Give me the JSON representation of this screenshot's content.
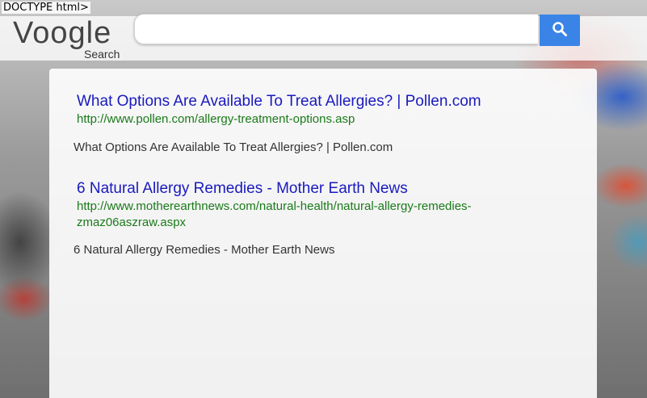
{
  "page": {
    "doctype_text": "DOCTYPE html>"
  },
  "header": {
    "logo": "Voogle",
    "logo_subtitle": "Search",
    "search_value": "",
    "search_icon": "search-icon",
    "accent_color": "#3a84e8"
  },
  "results": [
    {
      "title": "What Options Are Available To Treat Allergies? | Pollen.com",
      "url": "http://www.pollen.com/allergy-treatment-options.asp",
      "snippet": "What Options Are Available To Treat Allergies? | Pollen.com"
    },
    {
      "title": "6 Natural Allergy Remedies - Mother Earth News",
      "url": "http://www.motherearthnews.com/natural-health/natural-allergy-remedies-zmaz06aszraw.aspx",
      "snippet": "6 Natural Allergy Remedies - Mother Earth News"
    }
  ],
  "colors": {
    "title_link": "#1a1abf",
    "url_text": "#1a7a1a"
  }
}
